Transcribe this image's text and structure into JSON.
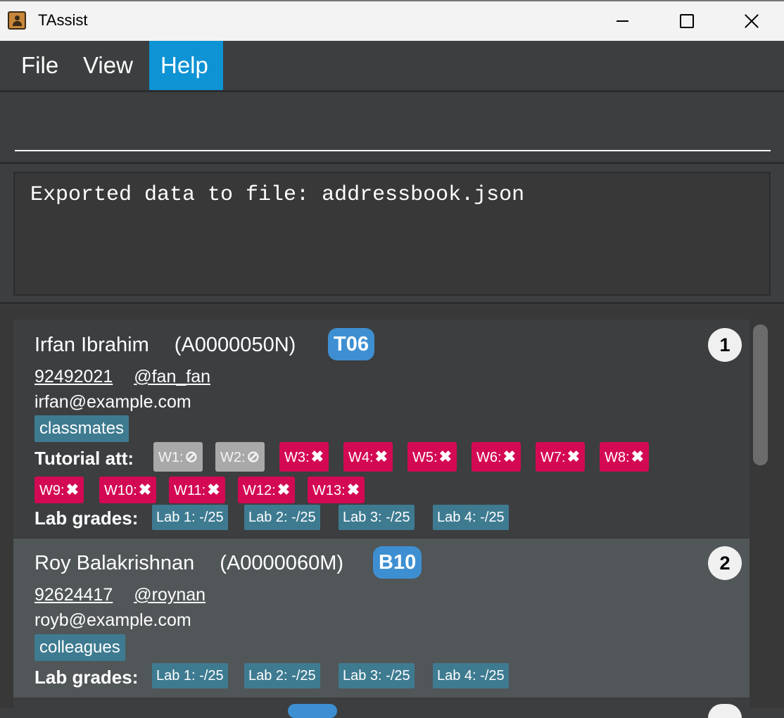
{
  "window": {
    "title": "TAssist"
  },
  "menu": {
    "file": "File",
    "view": "View",
    "help": "Help"
  },
  "command": {
    "value": ""
  },
  "result": {
    "text": "Exported data to file: addressbook.json"
  },
  "labels": {
    "tutorial_att": "Tutorial att:",
    "lab_grades": "Lab grades:"
  },
  "persons": [
    {
      "index": "1",
      "name": "Irfan Ibrahim",
      "student_id": "(A0000050N)",
      "group": "T06",
      "phone": "92492021",
      "telegram": "@fan_fan",
      "email": "irfan@example.com",
      "tag": "classmates",
      "attendance": [
        {
          "label": "W1:",
          "status": "not-applicable"
        },
        {
          "label": "W2:",
          "status": "not-applicable"
        },
        {
          "label": "W3:",
          "status": "absent"
        },
        {
          "label": "W4:",
          "status": "absent"
        },
        {
          "label": "W5:",
          "status": "absent"
        },
        {
          "label": "W6:",
          "status": "absent"
        },
        {
          "label": "W7:",
          "status": "absent"
        },
        {
          "label": "W8:",
          "status": "absent"
        },
        {
          "label": "W9:",
          "status": "absent"
        },
        {
          "label": "W10:",
          "status": "absent"
        },
        {
          "label": "W11:",
          "status": "absent"
        },
        {
          "label": "W12:",
          "status": "absent"
        },
        {
          "label": "W13:",
          "status": "absent"
        }
      ],
      "labs": [
        "Lab 1: -/25",
        "Lab 2: -/25",
        "Lab 3: -/25",
        "Lab 4: -/25"
      ]
    },
    {
      "index": "2",
      "name": "Roy Balakrishnan",
      "student_id": "(A0000060M)",
      "group": "B10",
      "phone": "92624417",
      "telegram": "@roynan",
      "email": "royb@example.com",
      "tag": "colleagues",
      "labs": [
        "Lab 1: -/25",
        "Lab 2: -/25",
        "Lab 3: -/25",
        "Lab 4: -/25"
      ]
    }
  ],
  "icons": {
    "absent": "cross-icon",
    "not_applicable": "prohibited-icon"
  },
  "colors": {
    "accent": "#0e93d4",
    "absent": "#d30a53",
    "not_applicable": "#a9a9a9",
    "tag": "#3e7b91",
    "group": "#3e8fd2"
  }
}
